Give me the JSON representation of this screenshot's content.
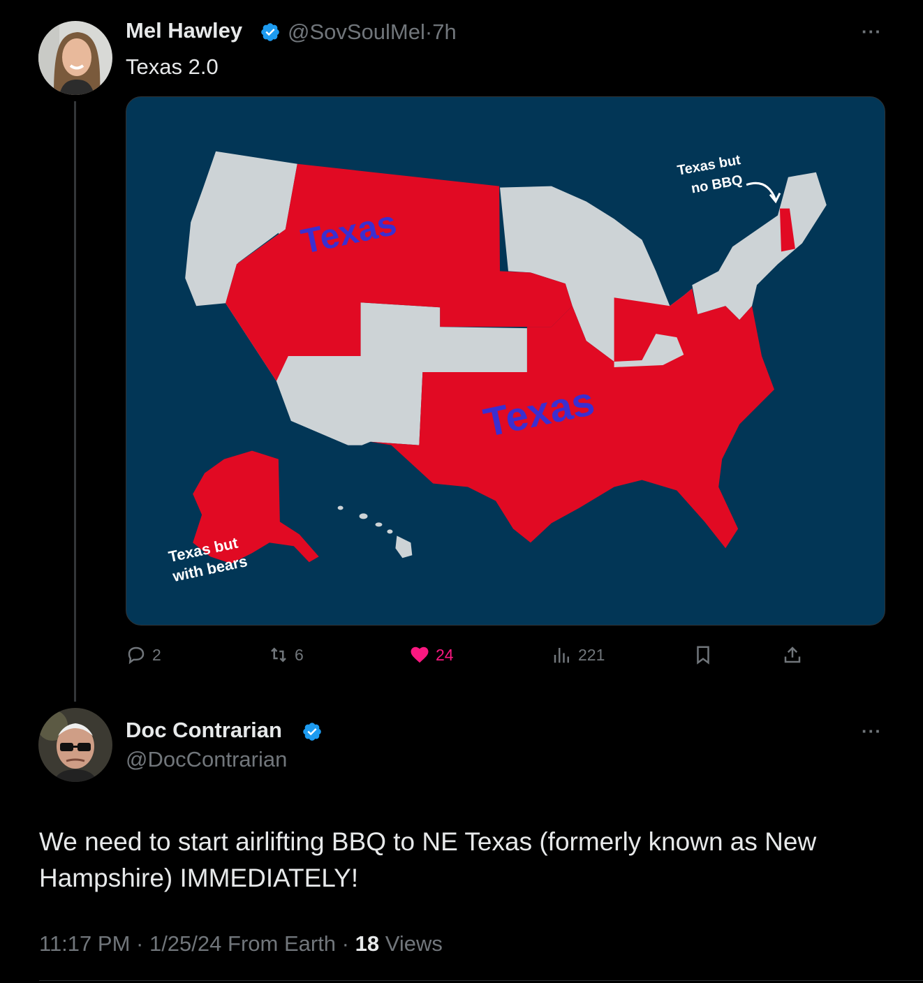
{
  "tweet": {
    "author_name": "Mel Hawley",
    "author_handle": "@SovSoulMel",
    "separator": "·",
    "time": "7h",
    "text": "Texas 2.0",
    "more": "···",
    "media": {
      "label_texas_west": "Texas",
      "label_texas_south": "Texas",
      "label_nh_line1": "Texas but",
      "label_nh_line2": "no BBQ",
      "label_ak_line1": "Texas but",
      "label_ak_line2": "with bears",
      "colors": {
        "background": "#023656",
        "texas": "#e10a23",
        "other": "#cdd3d6",
        "label_blue": "#3b2fd0"
      }
    },
    "actions": {
      "replies": "2",
      "reposts": "6",
      "likes": "24",
      "views": "221"
    }
  },
  "reply": {
    "author_name": "Doc Contrarian",
    "author_handle": "@DocContrarian",
    "more": "···",
    "text": "We need to start airlifting BBQ to NE Texas (formerly known as New Hampshire) IMMEDIATELY!",
    "time": "11:17 PM",
    "date": "1/25/24",
    "source": "From Earth",
    "views_count": "18",
    "views_label": "Views"
  },
  "colors": {
    "verified": "#1d9bf0",
    "like": "#f91880",
    "muted": "#71767b"
  }
}
